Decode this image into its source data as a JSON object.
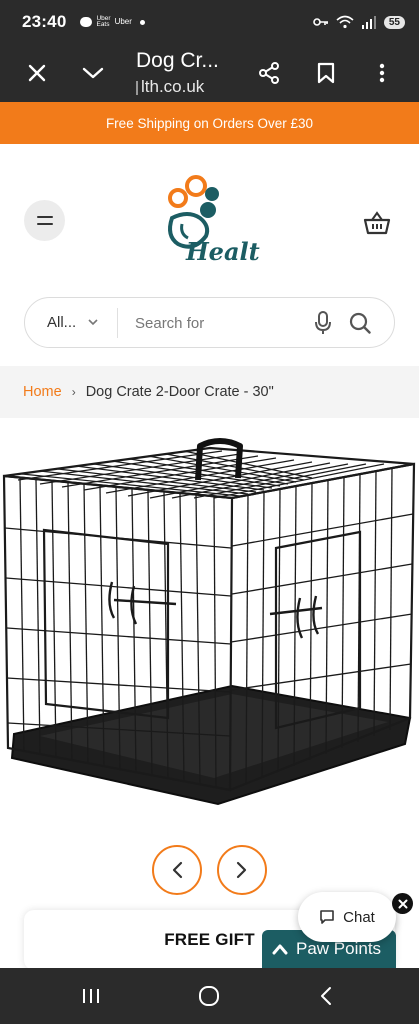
{
  "status_bar": {
    "time": "23:40",
    "notif_label_1": "Uber\nEats",
    "notif_label_2": "Uber",
    "battery": "55"
  },
  "browser": {
    "title": "Dog Cr...",
    "url": "lth.co.uk"
  },
  "promo": {
    "text": "Free Shipping on Orders Over £30"
  },
  "header": {
    "logo_text": "Health"
  },
  "search": {
    "category": "All...",
    "placeholder": "Search for"
  },
  "breadcrumb": {
    "home": "Home",
    "separator": "›",
    "current": "Dog Crate 2-Door Crate - 30\""
  },
  "gift": {
    "title": "FREE GIFT"
  },
  "chat": {
    "label": "Chat"
  },
  "paw_points": {
    "label": "Paw Points"
  },
  "colors": {
    "accent": "#f27b1a",
    "brand_teal": "#1c5d63",
    "dark_bar": "#2b2b2b"
  },
  "icons": {
    "status": [
      "key-icon",
      "wifi-icon",
      "signal-icon",
      "battery-icon"
    ],
    "browser": [
      "close-icon",
      "chevron-down-icon",
      "share-icon",
      "bookmark-icon",
      "more-vert-icon"
    ],
    "header": [
      "menu-icon",
      "cart-basket-icon"
    ],
    "search": [
      "chevron-down-icon",
      "mic-icon",
      "search-icon"
    ],
    "nav": [
      "recents-icon",
      "home-icon",
      "back-icon"
    ]
  }
}
